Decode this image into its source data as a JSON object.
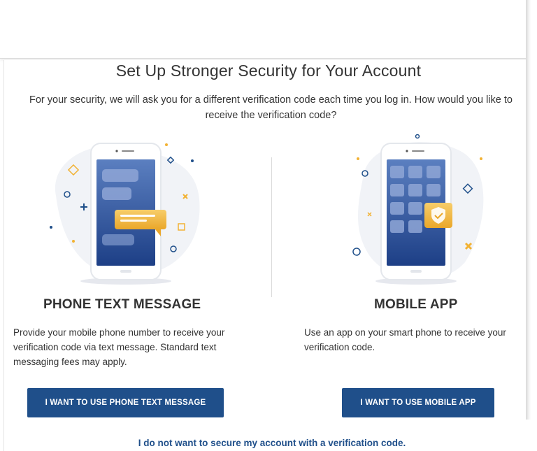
{
  "page": {
    "title": "Set Up Stronger Security for Your Account",
    "intro": "For your security, we will ask you for a different verification code each time you log in. How would you like to receive the verification code?"
  },
  "options": {
    "text": {
      "heading": "PHONE TEXT MESSAGE",
      "description": "Provide your mobile phone number to receive your verification code via text message. Standard text messaging fees may apply.",
      "button_label": "I WANT TO USE PHONE TEXT MESSAGE",
      "illustration_icon": "phone-chat-icon"
    },
    "app": {
      "heading": "MOBILE APP",
      "description": "Use an app on your smart phone to receive your verification code.",
      "button_label": "I WANT TO USE MOBILE APP",
      "illustration_icon": "phone-shield-app-icon"
    }
  },
  "skip_link": "I do not want to secure my account with a verification code.",
  "colors": {
    "primary": "#1f4f8a",
    "accent": "#f2b233",
    "screen_gradient_top": "#5b7fc0",
    "screen_gradient_bottom": "#1d3f86"
  }
}
